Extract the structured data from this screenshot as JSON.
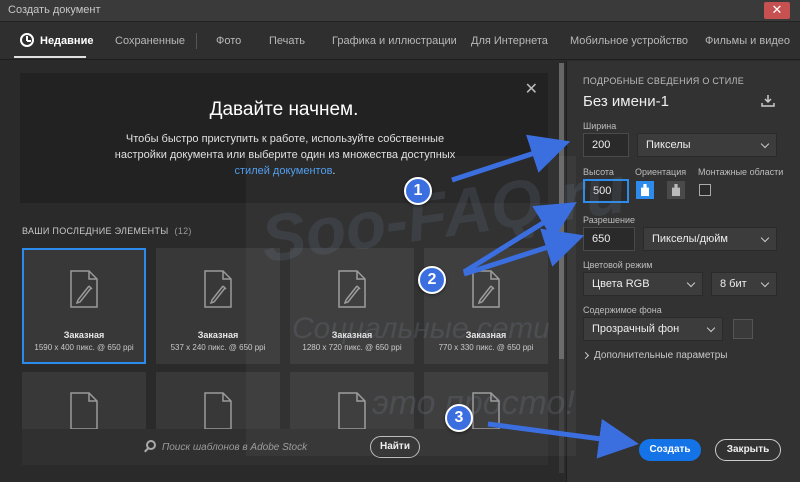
{
  "window": {
    "title": "Создать документ",
    "close_label": "✕"
  },
  "tabs": [
    {
      "label": "Недавние",
      "active": true
    },
    {
      "label": "Сохраненные"
    },
    {
      "label": "Фото"
    },
    {
      "label": "Печать"
    },
    {
      "label": "Графика и иллюстрации"
    },
    {
      "label": "Для Интернета"
    },
    {
      "label": "Мобильное устройство"
    },
    {
      "label": "Фильмы и видео"
    }
  ],
  "welcome": {
    "close_label": "✕",
    "title": "Давайте начнем.",
    "text": "Чтобы быстро приступить к работе, используйте собственные настройки документа или выберите один из множества доступных ",
    "link": "стилей документов",
    "text_end": "."
  },
  "recent": {
    "header": "ВАШИ ПОСЛЕДНИЕ ЭЛЕМЕНТЫ",
    "count": "(12)",
    "items": [
      {
        "name": "Заказная",
        "dims": "1590 x 400 пикс. @ 650 ppi",
        "selected": true
      },
      {
        "name": "Заказная",
        "dims": "537 x 240 пикс. @ 650 ppi"
      },
      {
        "name": "Заказная",
        "dims": "1280 x 720 пикс. @ 650 ppi"
      },
      {
        "name": "Заказная",
        "dims": "770 x 330 пикс. @ 650 ppi"
      }
    ]
  },
  "search": {
    "placeholder": "Поиск шаблонов в Adobe Stock",
    "button": "Найти"
  },
  "details": {
    "heading": "ПОДРОБНЫЕ СВЕДЕНИЯ О СТИЛЕ",
    "doc_name": "Без имени-1",
    "width_label": "Ширина",
    "width_value": "200",
    "width_unit": "Пикселы",
    "height_label": "Высота",
    "height_value": "500",
    "orientation_label": "Ориентация",
    "artboards_label": "Монтажные области",
    "resolution_label": "Разрешение",
    "resolution_value": "650",
    "resolution_unit": "Пикселы/дюйм",
    "color_mode_label": "Цветовой режим",
    "color_mode": "Цвета RGB",
    "bit_depth": "8 бит",
    "bg_label": "Содержимое фона",
    "bg_value": "Прозрачный фон",
    "advanced": "Дополнительные параметры"
  },
  "actions": {
    "create": "Создать",
    "close": "Закрыть"
  },
  "annotations": [
    "1",
    "2",
    "3"
  ],
  "watermark": {
    "main": "Soo-FAQ.ru",
    "line1": "Социальные сети",
    "line2": "это просто!"
  },
  "colors": {
    "accent": "#1473e6",
    "focus": "#2d8ceb",
    "badge": "#3b6fe0",
    "link": "#4b9cf0"
  }
}
